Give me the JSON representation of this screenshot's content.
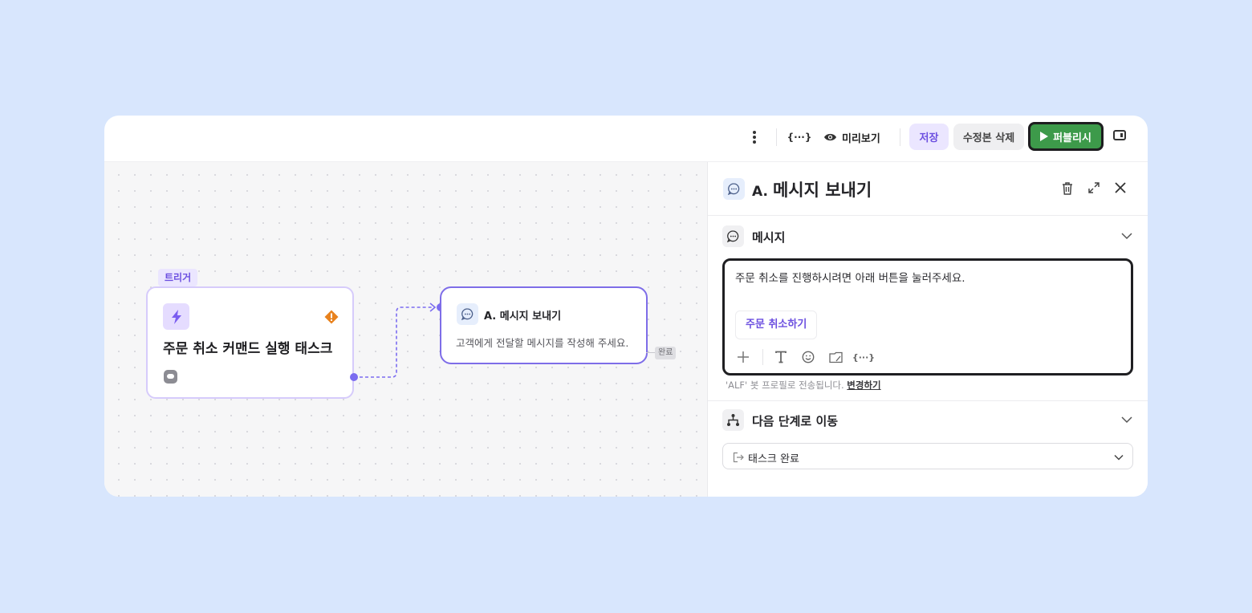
{
  "toolbar": {
    "variables_label": "{···}",
    "preview_label": "미리보기",
    "save_label": "저장",
    "delete_revision_label": "수정본 삭제",
    "publish_label": "퍼블리시"
  },
  "canvas": {
    "trigger_tag": "트리거",
    "trigger_title": "주문 취소 커맨드 실행 태스크",
    "message_node_title": "A. 메시지 보내기",
    "message_node_desc": "고객에게 전달할 메시지를 작성해 주세요.",
    "done_tag": "완료"
  },
  "panel": {
    "title_prefix": "A.",
    "title": "메시지 보내기",
    "message_section": {
      "label": "메시지",
      "text": "주문 취소를 진행하시려면 아래 버튼을 눌러주세요.",
      "button_label": "주문 취소하기",
      "profile_note": "'ALF' 봇 프로필로 전송됩니다.",
      "profile_change": "변경하기",
      "tool_variables": "{···}"
    },
    "next_section": {
      "label": "다음 단계로 이동",
      "selected": "태스크 완료"
    }
  },
  "colors": {
    "accent": "#6c4fe0",
    "publish": "#3d9a4a",
    "warning": "#e8821e",
    "background": "#d8e6fd"
  }
}
